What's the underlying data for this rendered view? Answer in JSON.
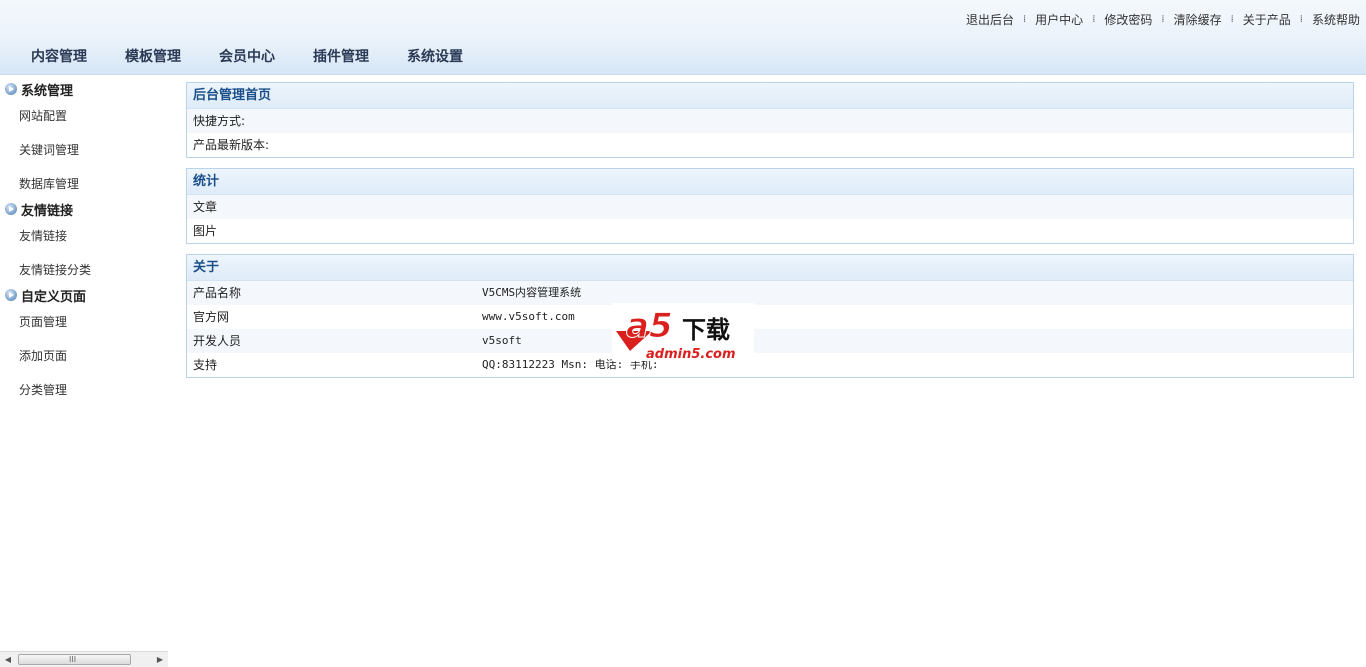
{
  "header": {
    "top_links": [
      "退出后台",
      "用户中心",
      "修改密码",
      "清除缓存",
      "关于产品",
      "系统帮助"
    ],
    "top_link_separator": "⁞",
    "nav": [
      "内容管理",
      "模板管理",
      "会员中心",
      "插件管理",
      "系统设置"
    ]
  },
  "sidebar": {
    "groups": [
      {
        "title": "系统管理",
        "items": [
          "网站配置",
          "关键词管理",
          "数据库管理"
        ]
      },
      {
        "title": "友情链接",
        "items": [
          "友情链接",
          "友情链接分类"
        ]
      },
      {
        "title": "自定义页面",
        "items": [
          "页面管理",
          "添加页面",
          "分类管理"
        ]
      }
    ]
  },
  "panels": {
    "home": {
      "title": "后台管理首页",
      "rows": [
        {
          "k": "快捷方式:"
        },
        {
          "k": "产品最新版本:"
        }
      ]
    },
    "stats": {
      "title": "统计",
      "rows": [
        {
          "k": "文章"
        },
        {
          "k": "图片"
        }
      ]
    },
    "about": {
      "title": "关于",
      "rows": [
        {
          "k": "产品名称",
          "v": "V5CMS内容管理系统"
        },
        {
          "k": "官方网",
          "v": "www.v5soft.com"
        },
        {
          "k": "开发人员",
          "v": "v5soft"
        },
        {
          "k": "支持",
          "v": "QQ:83112223 Msn: 电话: 手机:"
        }
      ]
    }
  },
  "watermark": {
    "logo_text": "a5",
    "cn_text": "下载",
    "site_text": "admin5.com"
  },
  "scrollbar": {
    "left_arrow": "◀",
    "right_arrow": "▶",
    "grip": "III"
  },
  "colors": {
    "accent": "#1a4f8a",
    "panel_border": "#b9d3ea",
    "header_bg": "#eaf2fa",
    "logo_red": "#d9201d"
  }
}
